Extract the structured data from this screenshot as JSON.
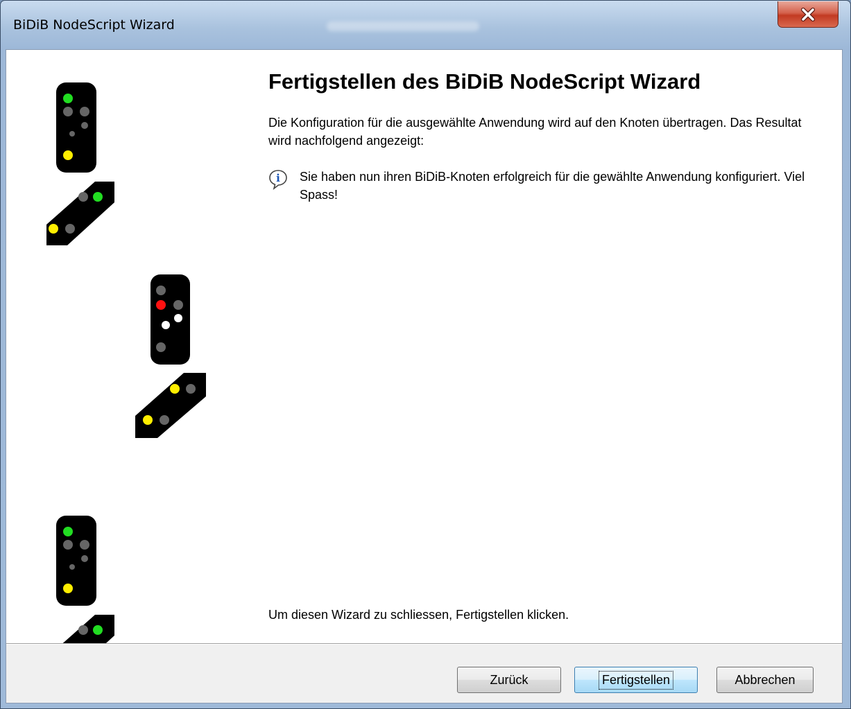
{
  "window": {
    "title": "BiDiB NodeScript Wizard"
  },
  "page": {
    "heading": "Fertigstellen des BiDiB NodeScript Wizard",
    "intro": "Die Konfiguration für die ausgewählte Anwendung wird auf den Knoten übertragen. Das Resultat wird nachfolgend angezeigt:",
    "info_message": "Sie haben nun ihren BiDiB-Knoten erfolgreich für die gewählte Anwendung konfiguriert. Viel Spass!",
    "closing_hint": "Um diesen Wizard zu schliessen, Fertigstellen klicken."
  },
  "buttons": {
    "back": "Zurück",
    "finish": "Fertigstellen",
    "cancel": "Abbrechen"
  },
  "colors": {
    "signal_body": "#000000",
    "lamp_off": "#666666",
    "lamp_green": "#22dd22",
    "lamp_yellow": "#ffee00",
    "lamp_red": "#ff1111",
    "lamp_white": "#ffffff"
  }
}
